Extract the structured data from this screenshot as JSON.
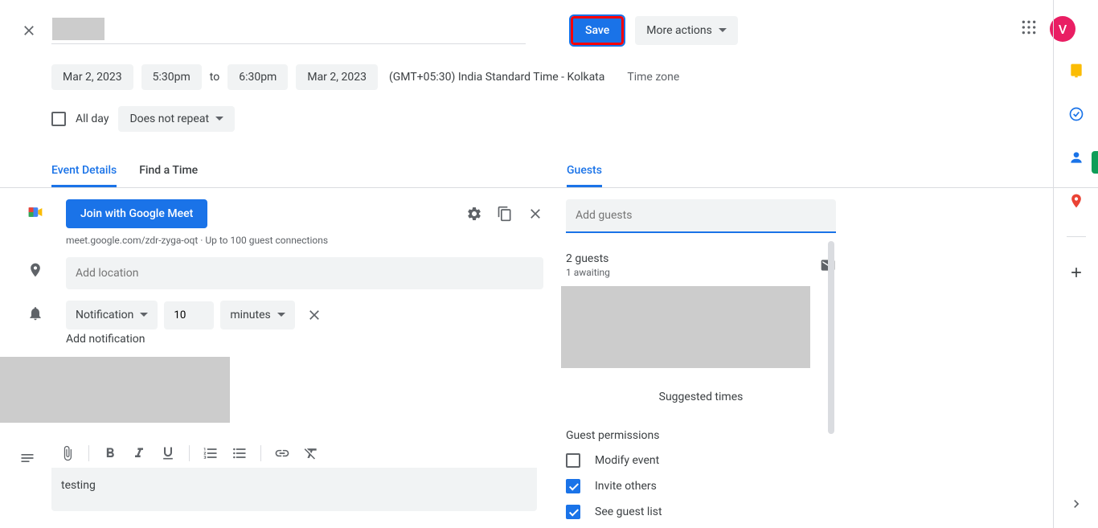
{
  "header": {
    "save_label": "Save",
    "more_actions_label": "More actions"
  },
  "datetime": {
    "start_date": "Mar 2, 2023",
    "start_time": "5:30pm",
    "to_label": "to",
    "end_time": "6:30pm",
    "end_date": "Mar 2, 2023",
    "timezone_text": "(GMT+05:30) India Standard Time - Kolkata",
    "timezone_link": "Time zone"
  },
  "allday": {
    "label": "All day",
    "repeat_label": "Does not repeat"
  },
  "tabs": {
    "event_details": "Event Details",
    "find_a_time": "Find a Time",
    "guests": "Guests"
  },
  "meet": {
    "join_label": "Join with Google Meet",
    "sub_text": "meet.google.com/zdr-zyga-oqt · Up to 100 guest connections"
  },
  "location": {
    "placeholder": "Add location"
  },
  "notification": {
    "type_label": "Notification",
    "value": "10",
    "unit_label": "minutes",
    "add_label": "Add notification"
  },
  "description": {
    "text": "testing"
  },
  "guests": {
    "placeholder": "Add guests",
    "count_text": "2 guests",
    "awaiting_text": "1 awaiting",
    "suggested_label": "Suggested times",
    "permissions_title": "Guest permissions",
    "perm_modify": "Modify event",
    "perm_invite": "Invite others",
    "perm_see": "See guest list"
  },
  "avatar": {
    "initial": "V"
  }
}
